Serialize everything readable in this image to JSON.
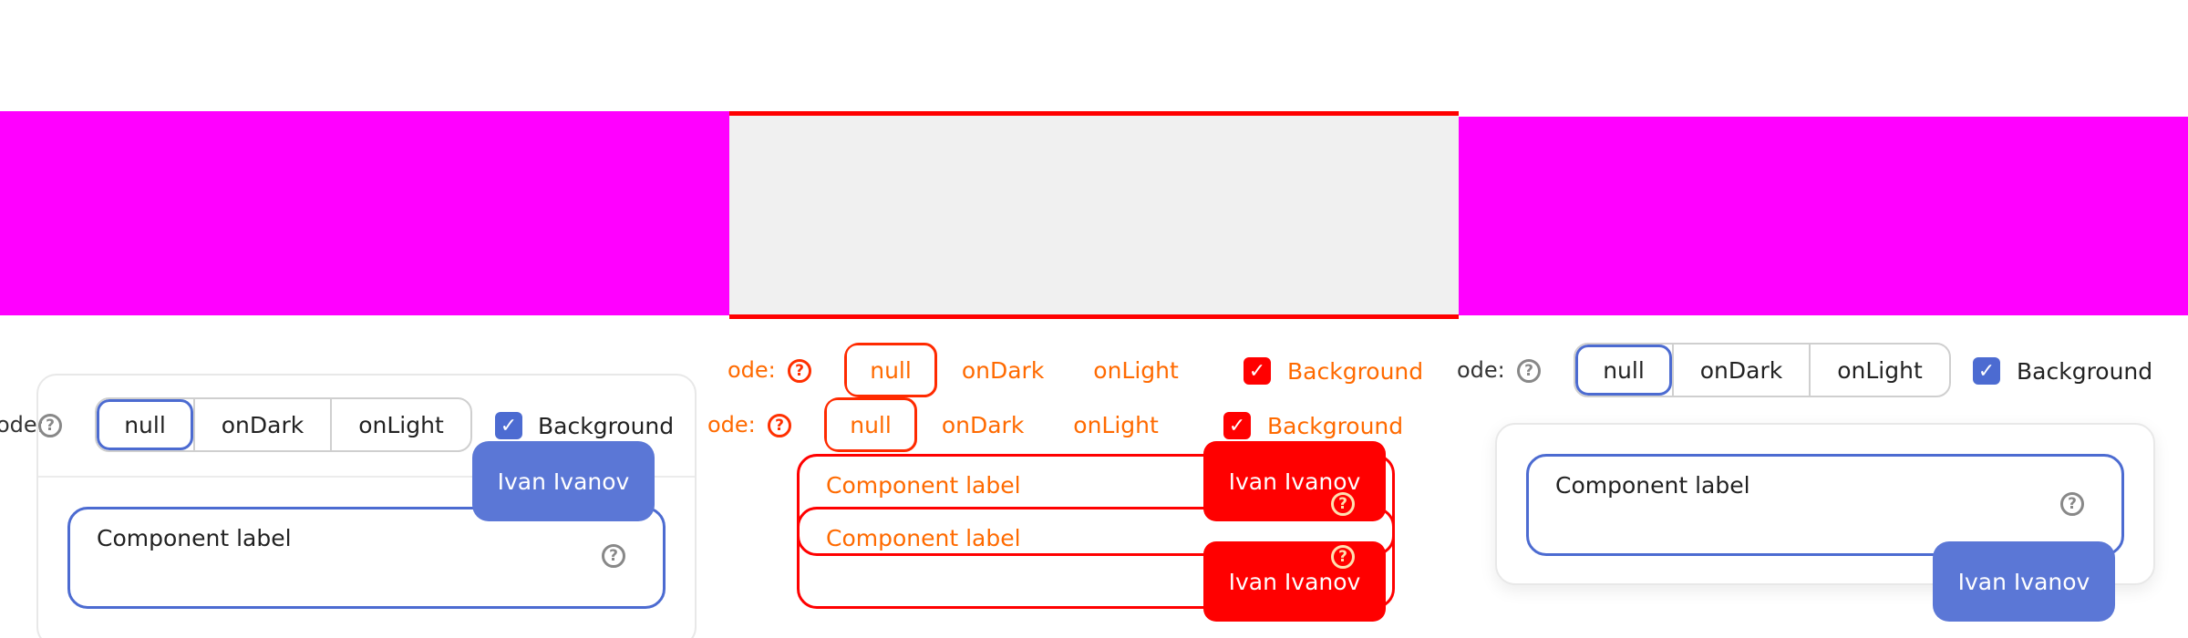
{
  "mode": {
    "label": "ode:",
    "options": [
      "null",
      "onDark",
      "onLight"
    ],
    "selected": "null"
  },
  "background_checkbox": {
    "label": "Background",
    "checked": true
  },
  "field": {
    "label": "Component label"
  },
  "tooltip": {
    "text": "Ivan Ivanov"
  },
  "colors": {
    "magenta": "#ff00ff",
    "accent_blue": "#4c6bd1",
    "tooltip_blue": "#5b77d6",
    "red": "#ff0000",
    "orange_text": "#ff6a00"
  },
  "icons": {
    "help": "help-circle-icon",
    "check": "checkmark-icon"
  }
}
